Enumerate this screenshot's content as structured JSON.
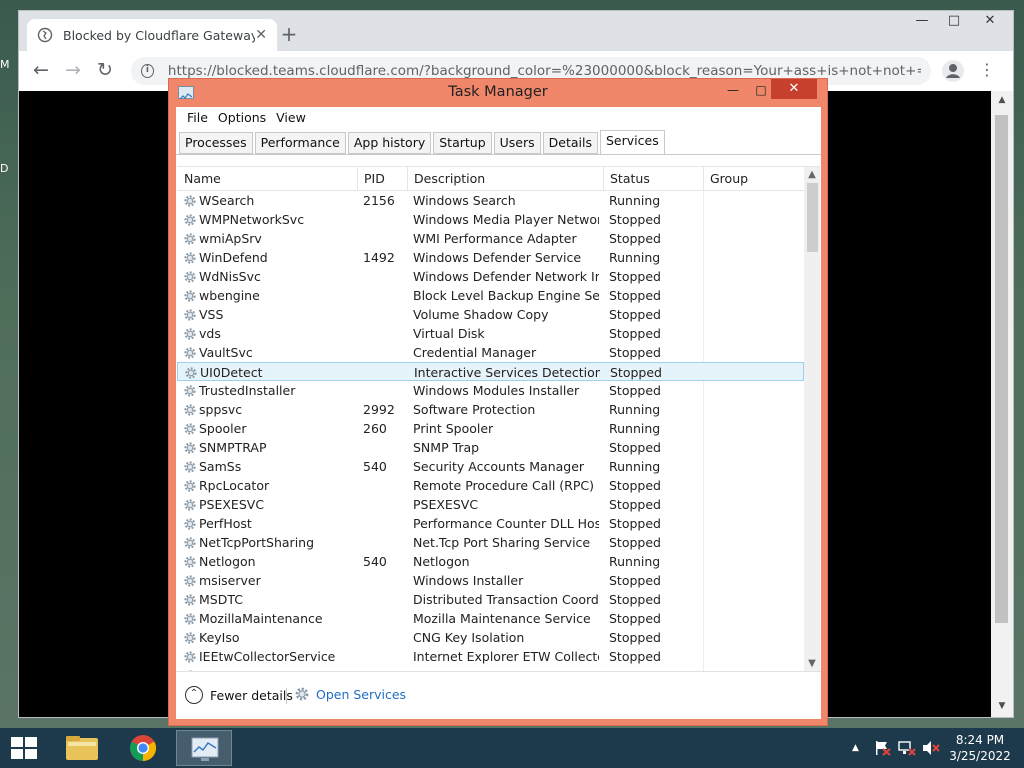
{
  "desktop": {
    "edge_labels": [
      "M",
      "D"
    ]
  },
  "browser": {
    "tab_title": "Blocked by Cloudflare Gateway",
    "tab_close": "✕",
    "new_tab": "+",
    "window_controls": {
      "minimize": "—",
      "maximize": "□",
      "close": "✕"
    },
    "nav": {
      "back": "←",
      "forward": "→",
      "reload": "↻"
    },
    "url": "https://blocked.teams.cloudflare.com/?background_color=%23000000&block_reason=Your+ass+is+not+not+=t&footer...",
    "menu": "⋮"
  },
  "task_manager": {
    "title": "Task Manager",
    "controls": {
      "minimize": "—",
      "maximize": "□",
      "close": "✕"
    },
    "menu": [
      "File",
      "Options",
      "View"
    ],
    "tabs": [
      "Processes",
      "Performance",
      "App history",
      "Startup",
      "Users",
      "Details",
      "Services"
    ],
    "active_tab": "Services",
    "columns": {
      "name": "Name",
      "pid": "PID",
      "description": "Description",
      "status": "Status",
      "group": "Group"
    },
    "selected_row": "UI0Detect",
    "rows": [
      {
        "name": "WSearch",
        "pid": "2156",
        "description": "Windows Search",
        "status": "Running"
      },
      {
        "name": "WMPNetworkSvc",
        "pid": "",
        "description": "Windows Media Player Network ...",
        "status": "Stopped"
      },
      {
        "name": "wmiApSrv",
        "pid": "",
        "description": "WMI Performance Adapter",
        "status": "Stopped"
      },
      {
        "name": "WinDefend",
        "pid": "1492",
        "description": "Windows Defender Service",
        "status": "Running"
      },
      {
        "name": "WdNisSvc",
        "pid": "",
        "description": "Windows Defender Network Insp...",
        "status": "Stopped"
      },
      {
        "name": "wbengine",
        "pid": "",
        "description": "Block Level Backup Engine Service",
        "status": "Stopped"
      },
      {
        "name": "VSS",
        "pid": "",
        "description": "Volume Shadow Copy",
        "status": "Stopped"
      },
      {
        "name": "vds",
        "pid": "",
        "description": "Virtual Disk",
        "status": "Stopped"
      },
      {
        "name": "VaultSvc",
        "pid": "",
        "description": "Credential Manager",
        "status": "Stopped"
      },
      {
        "name": "UI0Detect",
        "pid": "",
        "description": "Interactive Services Detection",
        "status": "Stopped"
      },
      {
        "name": "TrustedInstaller",
        "pid": "",
        "description": "Windows Modules Installer",
        "status": "Stopped"
      },
      {
        "name": "sppsvc",
        "pid": "2992",
        "description": "Software Protection",
        "status": "Running"
      },
      {
        "name": "Spooler",
        "pid": "260",
        "description": "Print Spooler",
        "status": "Running"
      },
      {
        "name": "SNMPTRAP",
        "pid": "",
        "description": "SNMP Trap",
        "status": "Stopped"
      },
      {
        "name": "SamSs",
        "pid": "540",
        "description": "Security Accounts Manager",
        "status": "Running"
      },
      {
        "name": "RpcLocator",
        "pid": "",
        "description": "Remote Procedure Call (RPC) Lo...",
        "status": "Stopped"
      },
      {
        "name": "PSEXESVC",
        "pid": "",
        "description": "PSEXESVC",
        "status": "Stopped"
      },
      {
        "name": "PerfHost",
        "pid": "",
        "description": "Performance Counter DLL Host",
        "status": "Stopped"
      },
      {
        "name": "NetTcpPortSharing",
        "pid": "",
        "description": "Net.Tcp Port Sharing Service",
        "status": "Stopped"
      },
      {
        "name": "Netlogon",
        "pid": "540",
        "description": "Netlogon",
        "status": "Running"
      },
      {
        "name": "msiserver",
        "pid": "",
        "description": "Windows Installer",
        "status": "Stopped"
      },
      {
        "name": "MSDTC",
        "pid": "",
        "description": "Distributed Transaction Coordin...",
        "status": "Stopped"
      },
      {
        "name": "MozillaMaintenance",
        "pid": "",
        "description": "Mozilla Maintenance Service",
        "status": "Stopped"
      },
      {
        "name": "KeyIso",
        "pid": "",
        "description": "CNG Key Isolation",
        "status": "Stopped"
      },
      {
        "name": "IEEtwCollectorService",
        "pid": "",
        "description": "Internet Explorer ETW Collector S...",
        "status": "Stopped"
      },
      {
        "name": "",
        "pid": "",
        "description": "",
        "status": ""
      }
    ],
    "fewer_details": "Fewer details",
    "open_services": "Open Services"
  },
  "taskbar": {
    "time": "8:24 PM",
    "date": "3/25/2022",
    "tray_arrow": "▲"
  },
  "colors": {
    "task_manager_frame": "#f0876a",
    "close_button": "#c7402d",
    "selection": "#e5f3fb",
    "link": "#1f6ec5",
    "taskbar": "#1d3a4c"
  }
}
